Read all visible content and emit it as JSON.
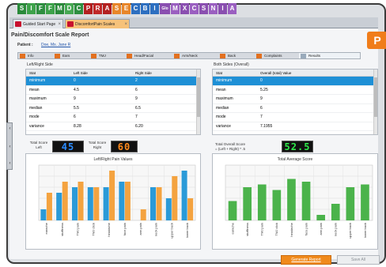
{
  "color_strip": [
    {
      "letter": "S",
      "color": "#2a8a3a"
    },
    {
      "letter": "I",
      "color": "#3da24a"
    },
    {
      "letter": "F",
      "color": "#2e8f40"
    },
    {
      "letter": "F",
      "color": "#3da24a"
    },
    {
      "letter": "M",
      "color": "#2a8a3a"
    },
    {
      "letter": "D",
      "color": "#46a852"
    },
    {
      "letter": "C",
      "color": "#2e8f40"
    },
    {
      "letter": "P",
      "color": "#b32020"
    },
    {
      "letter": "R",
      "color": "#c02828"
    },
    {
      "letter": "A",
      "color": "#b32020"
    },
    {
      "letter": "S",
      "color": "#e8862a"
    },
    {
      "letter": "E",
      "color": "#e8862a"
    },
    {
      "letter": "C",
      "color": "#2d6fc0"
    },
    {
      "letter": "B",
      "color": "#2d6fc0"
    },
    {
      "letter": "I",
      "color": "#2d6fc0"
    },
    {
      "letter": "Glo",
      "color": "#8a4fb0"
    },
    {
      "letter": "M",
      "color": "#9a5fc0"
    },
    {
      "letter": "X",
      "color": "#8a4fb0"
    },
    {
      "letter": "C",
      "color": "#9a5fc0"
    },
    {
      "letter": "S",
      "color": "#8a4fb0"
    },
    {
      "letter": "N",
      "color": "#9a5fc0"
    },
    {
      "letter": "I",
      "color": "#8a4fb0"
    },
    {
      "letter": "A",
      "color": "#9a5fc0"
    }
  ],
  "tabs": [
    {
      "label": "Guided Start Page",
      "active": false
    },
    {
      "label": "DiscomfortPain Scales",
      "active": true
    }
  ],
  "report": {
    "title": "Pain/Discomfort Scale Report",
    "patient_label": "Patient :",
    "patient_name": "Doe, Ms. Jane R",
    "logo_letter": "P"
  },
  "sections": [
    "Info",
    "Ears",
    "TMJ",
    "Head/Facial",
    "Arm/Neck",
    "Back",
    "Complaints",
    "Results"
  ],
  "left_grid": {
    "title": "Left/Right Side",
    "headers": [
      "Stat",
      "Left Side",
      "Right Side"
    ],
    "rows": [
      [
        "minimum",
        "0",
        "2"
      ],
      [
        "mean",
        "4.5",
        "6"
      ],
      [
        "maximum",
        "9",
        "9"
      ],
      [
        "median",
        "5.5",
        "6.5"
      ],
      [
        "mode",
        "6",
        "7"
      ],
      [
        "variance",
        "8.28",
        "6.20"
      ]
    ]
  },
  "right_grid": {
    "title": "Both Sides (Overall)",
    "headers": [
      "Stat",
      "Overall (total) Value"
    ],
    "rows": [
      [
        "minimum",
        "0"
      ],
      [
        "mean",
        "5.25"
      ],
      [
        "maximum",
        "9"
      ],
      [
        "median",
        "6"
      ],
      [
        "mode",
        "7"
      ],
      [
        "variance",
        "7.1955"
      ]
    ]
  },
  "scores": {
    "left_label": "Total Score\nLeft",
    "left_value": "45",
    "left_color": "#2b8cff",
    "right_label": "Total Score\nRight",
    "right_value": "60",
    "right_color": "#ff8a1c",
    "overall_label": "Total Overall Score\n= (Left + Right) * .5",
    "overall_value": "52.5",
    "overall_color": "#2ee84a"
  },
  "chart_data": [
    {
      "type": "bar",
      "title": "Left/Right Pain Values",
      "categories": [
        "earache",
        "stuffiness",
        "TMJ pain",
        "TMJ click",
        "headache",
        "face pain",
        "arm pain",
        "neck pain",
        "upper back",
        "lower back"
      ],
      "series": [
        {
          "values": [
            2,
            5,
            6,
            6,
            6,
            7,
            0,
            6,
            4,
            9
          ],
          "color": "#2a9ad8"
        },
        {
          "values": [
            5,
            7,
            7,
            6,
            9,
            7,
            2,
            6,
            8,
            4
          ],
          "color": "#f4a340"
        }
      ],
      "ylim": [
        0,
        10
      ],
      "grid": true
    },
    {
      "type": "bar",
      "title": "Total Average Score",
      "categories": [
        "earache",
        "stuffiness",
        "TMJ pain",
        "TMJ click",
        "headache",
        "face pain",
        "arm pain",
        "neck pain",
        "upper back",
        "lower back"
      ],
      "series": [
        {
          "values": [
            3.5,
            6,
            6.5,
            5.5,
            7.5,
            7,
            1,
            3,
            6,
            6.5
          ],
          "color": "#4bb34b"
        }
      ],
      "ylim": [
        0,
        10
      ],
      "grid": true
    }
  ],
  "buttons": {
    "generate": "Generate Report",
    "save": "Save All"
  }
}
